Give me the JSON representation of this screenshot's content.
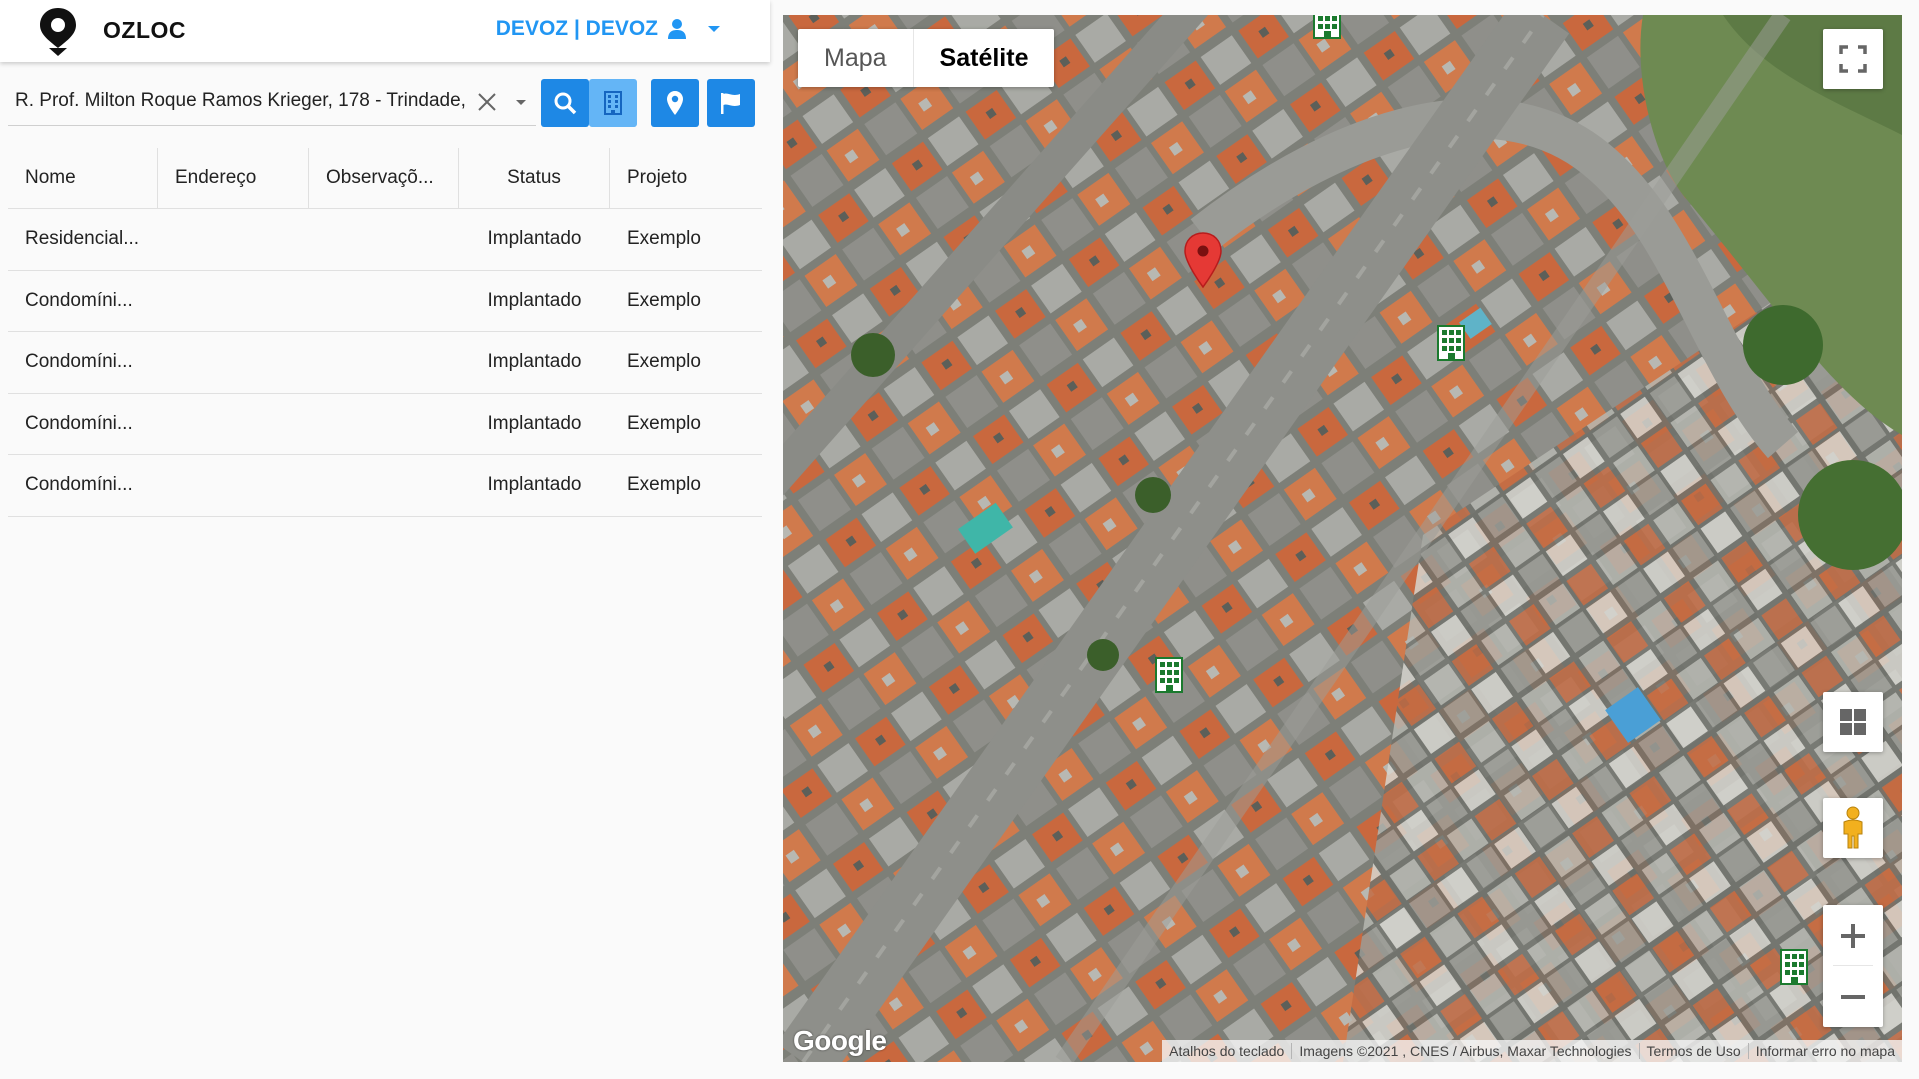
{
  "header": {
    "app_title": "OZLOC",
    "user_label": "DEVOZ | DEVOZ",
    "accent_color": "#2196f3",
    "logo_icon": "map-pin-logo",
    "user_icon": "person-icon",
    "user_caret_icon": "caret-down-icon"
  },
  "search": {
    "value": "R. Prof. Milton Roque Ramos Krieger, 178 - Trindade,",
    "clear_icon": "close-icon",
    "dropdown_icon": "chevron-down-icon",
    "buttons": [
      {
        "icon": "search-icon",
        "color": "#1e88e5"
      },
      {
        "icon": "building-icon",
        "color": "#64b5f6"
      },
      {
        "icon": "map-marker-icon",
        "color": "#1e88e5"
      },
      {
        "icon": "flag-icon",
        "color": "#1e88e5"
      }
    ]
  },
  "table": {
    "columns": [
      "Nome",
      "Endereço",
      "Observaçõ...",
      "Status",
      "Projeto"
    ],
    "rows": [
      {
        "nome": "Residencial...",
        "endereco": "",
        "observacao": "",
        "status": "Implantado",
        "projeto": "Exemplo"
      },
      {
        "nome": "Condomíni...",
        "endereco": "",
        "observacao": "",
        "status": "Implantado",
        "projeto": "Exemplo"
      },
      {
        "nome": "Condomíni...",
        "endereco": "",
        "observacao": "",
        "status": "Implantado",
        "projeto": "Exemplo"
      },
      {
        "nome": "Condomíni...",
        "endereco": "",
        "observacao": "",
        "status": "Implantado",
        "projeto": "Exemplo"
      },
      {
        "nome": "Condomíni...",
        "endereco": "",
        "observacao": "",
        "status": "Implantado",
        "projeto": "Exemplo"
      }
    ]
  },
  "map": {
    "map_type_options": [
      "Mapa",
      "Satélite"
    ],
    "selected_map_type": "Satélite",
    "controls": [
      "fullscreen-icon",
      "layers-grid-icon",
      "pegman-icon",
      "zoom-in-icon",
      "zoom-out-icon"
    ],
    "google_logo": "Google",
    "attribution": {
      "keyboard": "Atalhos do teclado",
      "imagery": "Imagens ©2021 , CNES / Airbus, Maxar Technologies",
      "terms": "Termos de Uso",
      "report": "Informar erro no mapa"
    },
    "marker_color": "#e53935",
    "building_marker_color": "#1b7a2e"
  }
}
